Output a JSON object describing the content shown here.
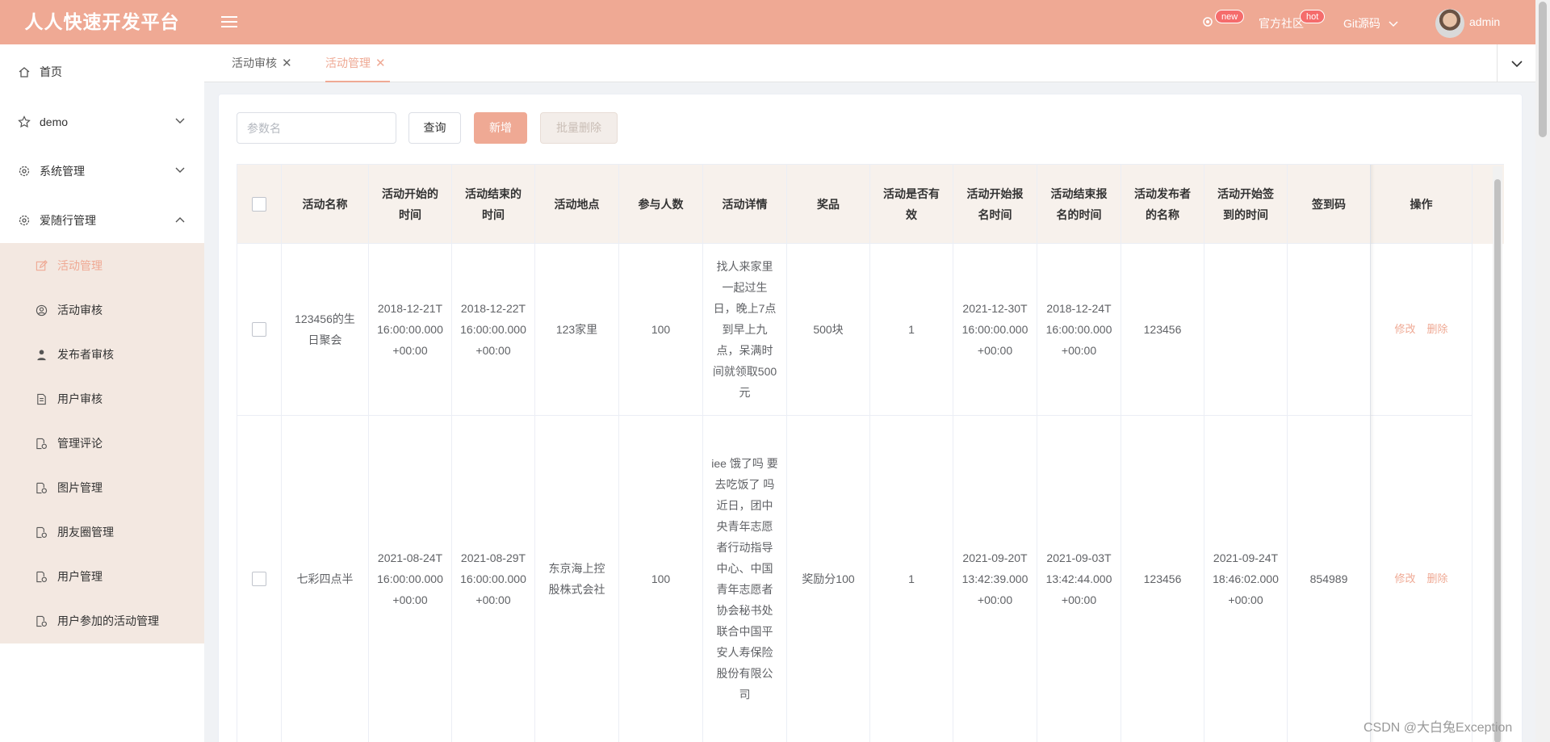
{
  "header": {
    "brand": "人人快速开发平台",
    "badge_new": "new",
    "community": "官方社区",
    "badge_hot": "hot",
    "git": "Git源码",
    "username": "admin"
  },
  "sidebar": {
    "items": [
      {
        "label": "首页",
        "icon": "home-icon"
      },
      {
        "label": "demo",
        "icon": "star-icon"
      },
      {
        "label": "系统管理",
        "icon": "gear-icon"
      },
      {
        "label": "爱随行管理",
        "icon": "gear-icon"
      }
    ],
    "subitems": [
      {
        "label": "活动管理",
        "icon": "edit-icon",
        "active": true
      },
      {
        "label": "活动审核",
        "icon": "user-circle-icon"
      },
      {
        "label": "发布者审核",
        "icon": "person-icon"
      },
      {
        "label": "用户审核",
        "icon": "document-icon"
      },
      {
        "label": "管理评论",
        "icon": "document-gear-icon"
      },
      {
        "label": "图片管理",
        "icon": "document-gear-icon"
      },
      {
        "label": "朋友圈管理",
        "icon": "document-gear-icon"
      },
      {
        "label": "用户管理",
        "icon": "document-gear-icon"
      },
      {
        "label": "用户参加的活动管理",
        "icon": "document-gear-icon"
      }
    ]
  },
  "tabs": [
    {
      "label": "活动审核",
      "active": false
    },
    {
      "label": "活动管理",
      "active": true
    }
  ],
  "toolbar": {
    "search_placeholder": "参数名",
    "query_label": "查询",
    "add_label": "新增",
    "batch_delete_label": "批量删除"
  },
  "table": {
    "headers": [
      "活动名称",
      "活动开始的时间",
      "活动结束的时间",
      "活动地点",
      "参与人数",
      "活动详情",
      "奖品",
      "活动是否有效",
      "活动开始报名时间",
      "活动结束报名的时间",
      "活动发布者的名称",
      "活动开始签到的时间",
      "签到码",
      "操作"
    ],
    "rows": [
      [
        "123456的生日聚会",
        "2018-12-21T16:00:00.000+00:00",
        "2018-12-22T16:00:00.000+00:00",
        "123家里",
        "100",
        "找人来家里一起过生日，晚上7点到早上九点，呆满时间就领取500元",
        "500块",
        "1",
        "2021-12-30T16:00:00.000+00:00",
        "2018-12-24T16:00:00.000+00:00",
        "123456",
        "",
        ""
      ],
      [
        "七彩四点半",
        "2021-08-24T16:00:00.000+00:00",
        "2021-08-29T16:00:00.000+00:00",
        "东京海上控股株式会社",
        "100",
        "iee 饿了吗 要去吃饭了 吗 近日，团中央青年志愿者行动指导中心、中国青年志愿者协会秘书处联合中国平安人寿保险股份有限公司",
        "奖励分100",
        "1",
        "2021-09-20T13:42:39.000+00:00",
        "2021-09-03T13:42:44.000+00:00",
        "123456",
        "2021-09-24T18:46:02.000+00:00",
        "854989"
      ]
    ],
    "op_edit": "修改",
    "op_delete": "删除"
  },
  "watermark": "CSDN @大白兔Exception",
  "colors": {
    "accent": "#efa994",
    "submenu_bg": "#f3e8e1",
    "header_bg": "#f7f1ec"
  }
}
